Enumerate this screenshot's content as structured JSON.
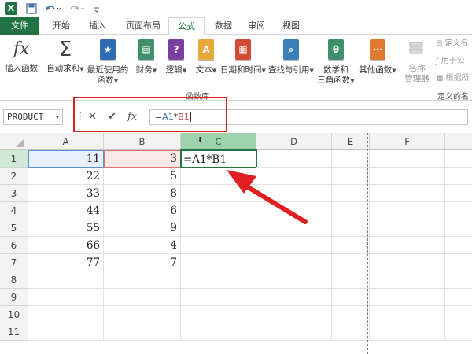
{
  "quick_access": {
    "excel_logo": "X",
    "save_icon": "save-icon",
    "undo_icon": "undo-icon",
    "redo_icon": "redo-icon"
  },
  "tabs": [
    {
      "label": "文件"
    },
    {
      "label": "开始"
    },
    {
      "label": "插入"
    },
    {
      "label": "页面布局"
    },
    {
      "label": "公式"
    },
    {
      "label": "数据"
    },
    {
      "label": "审阅"
    },
    {
      "label": "视图"
    }
  ],
  "ribbon": {
    "insert_function": {
      "symbol": "fx",
      "label": "插入函数"
    },
    "autosum": {
      "symbol": "Σ",
      "label": "自动求和"
    },
    "recently_used": {
      "symbol": "★",
      "label1": "最近使用的",
      "label2": "函数"
    },
    "financial": {
      "symbol": "▤",
      "label": "财务"
    },
    "logical": {
      "symbol": "?",
      "label": "逻辑"
    },
    "text": {
      "symbol": "A",
      "label": "文本"
    },
    "datetime": {
      "symbol": "▦",
      "label": "日期和时间"
    },
    "lookup": {
      "symbol": "⌕",
      "label": "查找与引用"
    },
    "math": {
      "symbol": "θ",
      "label1": "数学和",
      "label2": "三角函数"
    },
    "other": {
      "symbol": "⋯",
      "label": "其他函数"
    },
    "group_label": "函数库",
    "name_manager": {
      "label1": "名称",
      "label2": "管理器"
    },
    "define_name": "定义名",
    "use_in_formula": "用于公",
    "create_from_selection": "根据所",
    "defined_names_group": "定义的名"
  },
  "formula_bar": {
    "name_box": "PRODUCT",
    "cancel_symbol": "✕",
    "enter_symbol": "✔",
    "fx_symbol": "fx",
    "formula_eq": "=",
    "formula_ref1": "A1",
    "formula_op": "*",
    "formula_ref2": "B1"
  },
  "columns": [
    "A",
    "B",
    "C",
    "D",
    "E",
    "F"
  ],
  "rows": [
    "1",
    "2",
    "3",
    "4",
    "5",
    "6",
    "7",
    "8",
    "9",
    "10",
    "11"
  ],
  "cells": {
    "A": [
      "11",
      "22",
      "33",
      "44",
      "55",
      "66",
      "77"
    ],
    "B": [
      "3",
      "5",
      "8",
      "6",
      "9",
      "4",
      "7"
    ],
    "C1": "=A1*B1"
  },
  "colors": {
    "excel_green": "#217346",
    "ref_blue": "#5b8fd6",
    "ref_red": "#e07070",
    "annotation_red": "#e02020"
  }
}
